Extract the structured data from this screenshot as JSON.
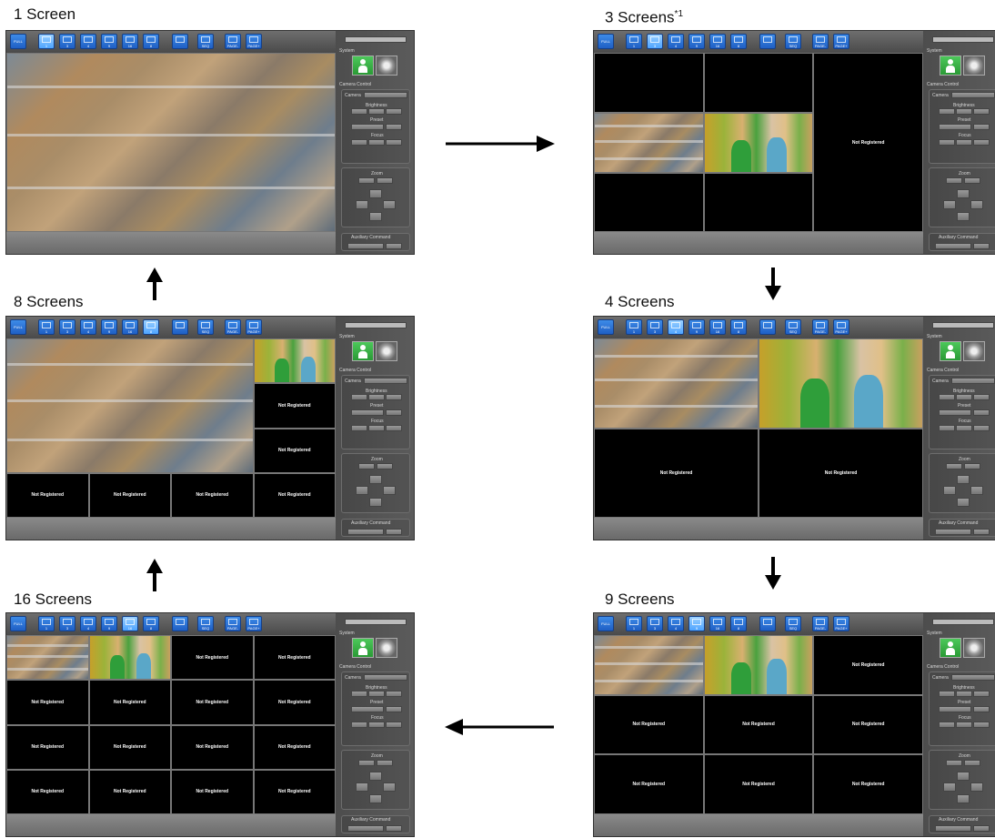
{
  "panels": [
    {
      "key": "p1",
      "title": "1 Screen",
      "sup": ""
    },
    {
      "key": "p3",
      "title": "3 Screens",
      "sup": "*1"
    },
    {
      "key": "p8",
      "title": "8 Screens",
      "sup": ""
    },
    {
      "key": "p4",
      "title": "4 Screens",
      "sup": ""
    },
    {
      "key": "p16",
      "title": "16 Screens",
      "sup": ""
    },
    {
      "key": "p9",
      "title": "9 Screens",
      "sup": ""
    }
  ],
  "toolbar": {
    "full": "FULL",
    "n1": "1",
    "n3": "3",
    "n4": "4",
    "n9": "9",
    "n16": "16",
    "n8": "8",
    "seq": "SEQ",
    "page_prev": "PAGE-",
    "page_next": "PAGE+"
  },
  "side": {
    "system": "System",
    "camera_control": "Camera Control",
    "camera": "Camera",
    "brightness": "Brightness",
    "preset": "Preset",
    "focus": "Focus",
    "zoom": "Zoom",
    "auxiliary": "Auxiliary Command"
  },
  "cell_text": "Not Registered"
}
